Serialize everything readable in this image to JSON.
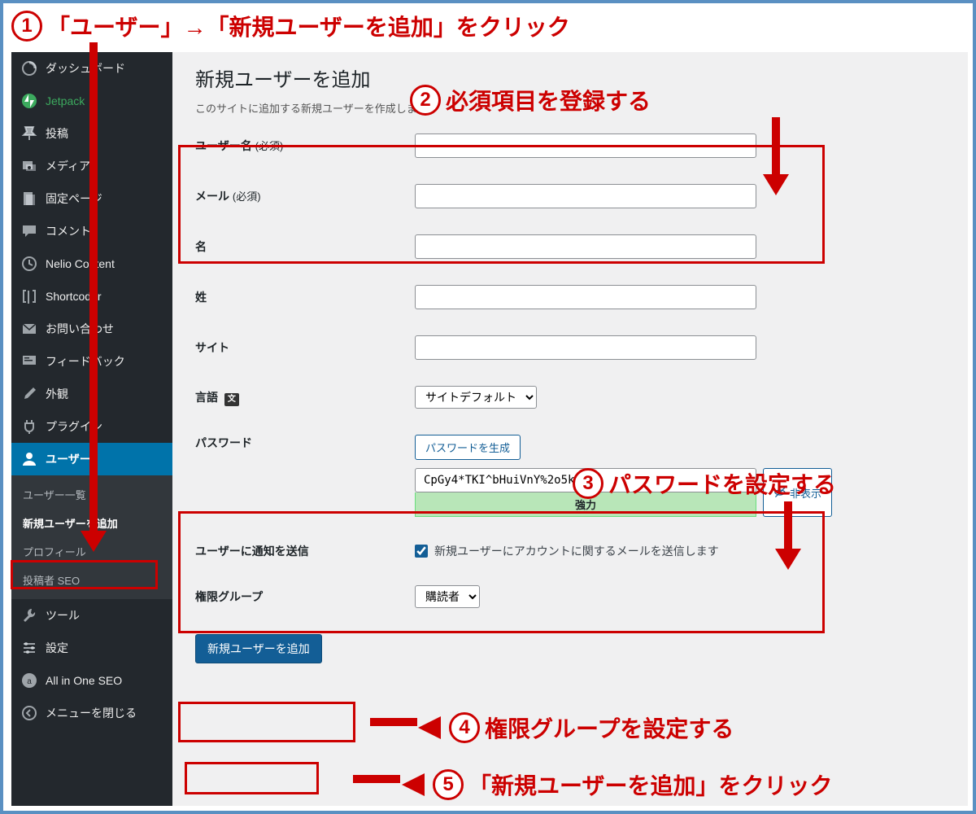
{
  "instructions": {
    "i1": "「ユーザー」→「新規ユーザーを追加」をクリック",
    "i2": "必須項目を登録する",
    "i3": "パスワードを設定する",
    "i4": "権限グループを設定する",
    "i5": "「新規ユーザーを追加」をクリック"
  },
  "sidebar": {
    "dashboard": "ダッシュボード",
    "jetpack": "Jetpack",
    "posts": "投稿",
    "media": "メディア",
    "pages": "固定ページ",
    "comments": "コメント",
    "nelio": "Nelio Content",
    "shortcoder": "Shortcoder",
    "contact": "お問い合わせ",
    "feedback": "フィードバック",
    "appearance": "外観",
    "plugins": "プラグイン",
    "users": "ユーザー",
    "tools": "ツール",
    "settings": "設定",
    "aioseo": "All in One SEO",
    "collapse": "メニューを閉じる",
    "sub": {
      "user_list": "ユーザー一覧",
      "add_new": "新規ユーザーを追加",
      "profile": "プロフィール",
      "author_seo": "投稿者 SEO"
    }
  },
  "main": {
    "title": "新規ユーザーを追加",
    "desc": "このサイトに追加する新規ユーザーを作成します。",
    "labels": {
      "username": "ユーザー名",
      "username_req": "(必須)",
      "email": "メール",
      "email_req": "(必須)",
      "firstname": "名",
      "lastname": "姓",
      "website": "サイト",
      "language": "言語",
      "password": "パスワード",
      "notify": "ユーザーに通知を送信",
      "role": "権限グループ"
    },
    "language_select": "サイトデフォルト",
    "pw_generate": "パスワードを生成",
    "pw_value": "CpGy4*TKI^bHuiVnY%2o5kc6",
    "pw_hide": "非表示",
    "pw_strength": "強力",
    "notify_text": "新規ユーザーにアカウントに関するメールを送信します",
    "role_select": "購読者",
    "submit": "新規ユーザーを追加"
  }
}
